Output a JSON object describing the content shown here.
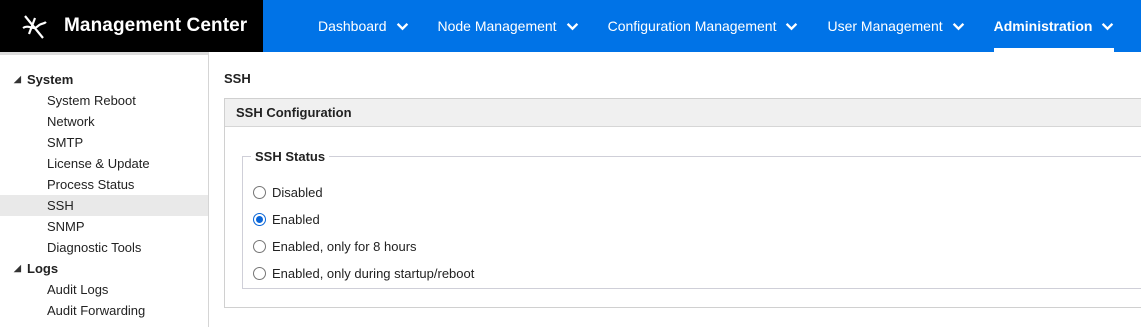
{
  "app": {
    "title": "Management Center"
  },
  "nav": [
    {
      "label": "Dashboard",
      "active": false
    },
    {
      "label": "Node Management",
      "active": false
    },
    {
      "label": "Configuration Management",
      "active": false
    },
    {
      "label": "User Management",
      "active": false
    },
    {
      "label": "Administration",
      "active": true
    }
  ],
  "sidebar": {
    "groups": [
      {
        "label": "System",
        "items": [
          "System Reboot",
          "Network",
          "SMTP",
          "License & Update",
          "Process Status",
          "SSH",
          "SNMP",
          "Diagnostic Tools"
        ]
      },
      {
        "label": "Logs",
        "items": [
          "Audit Logs",
          "Audit Forwarding"
        ]
      }
    ],
    "selected": "SSH"
  },
  "page": {
    "title": "SSH",
    "panel_title": "SSH Configuration",
    "fieldset_legend": "SSH Status",
    "options": [
      {
        "label": "Disabled",
        "checked": false
      },
      {
        "label": "Enabled",
        "checked": true
      },
      {
        "label": "Enabled, only for 8 hours",
        "checked": false
      },
      {
        "label": "Enabled, only during startup/reboot",
        "checked": false
      }
    ]
  },
  "colors": {
    "topbar": "#0073e7",
    "brand_bg": "#000000",
    "radio_accent": "#0a66d8"
  }
}
